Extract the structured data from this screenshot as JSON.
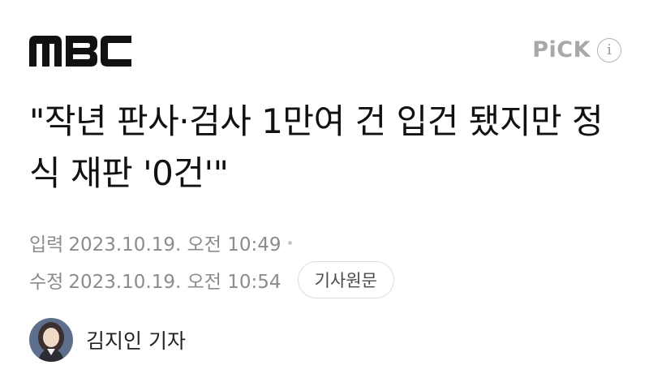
{
  "header": {
    "logo_text": "MBC",
    "pick_label": "PiCK",
    "info_icon": "info-icon"
  },
  "article": {
    "headline": "\"작년 판사·검사 1만여 건 입건 됐지만 정식 재판 '0건'\"",
    "input_label": "입력",
    "input_time": "2023.10.19. 오전 10:49",
    "edit_label": "수정",
    "edit_time": "2023.10.19. 오전 10:54",
    "original_button": "기사원문"
  },
  "reporter": {
    "name": "김지인 기자",
    "avatar_icon": "reporter-avatar"
  },
  "colors": {
    "text": "#111111",
    "meta": "#8c8c8c",
    "pick": "#a8a8a8",
    "border": "#dedede"
  }
}
